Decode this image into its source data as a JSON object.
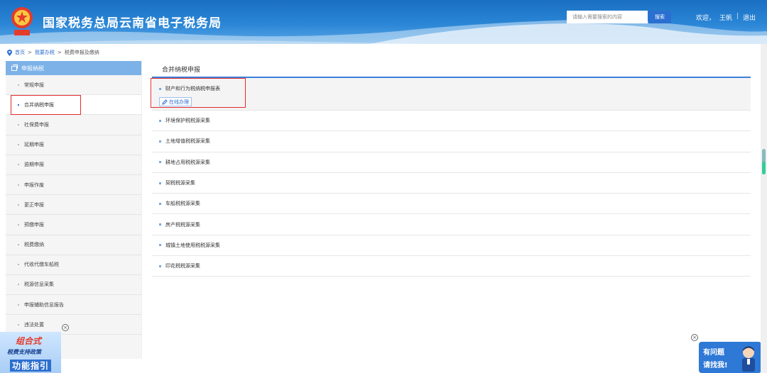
{
  "header": {
    "site_title": "国家税务总局云南省电子税务局",
    "search_placeholder": "请输入需要搜索的内容",
    "search_button": "搜索",
    "welcome": "欢迎，",
    "user_name": "王帆",
    "separator": "|",
    "logout": "退出"
  },
  "breadcrumb": {
    "home": "首页",
    "sep1": ">",
    "level1": "我要办税",
    "sep2": ">",
    "current": "税费申报及缴纳"
  },
  "sidebar": {
    "header": "申报纳税",
    "items": [
      {
        "label": "常规申报"
      },
      {
        "label": "合并纳税申报"
      },
      {
        "label": "社保费申报"
      },
      {
        "label": "延期申报"
      },
      {
        "label": "逾期申报"
      },
      {
        "label": "申报作废"
      },
      {
        "label": "更正申报"
      },
      {
        "label": "预缴申报"
      },
      {
        "label": "税费缴纳"
      },
      {
        "label": "代收代缴车船税"
      },
      {
        "label": "税源信息采集"
      },
      {
        "label": "申报辅助信息报告"
      },
      {
        "label": "违法处置"
      }
    ],
    "close_symbol": "×"
  },
  "main": {
    "title": "合并纳税申报",
    "rows": [
      {
        "label": "财产和行为税纳税申报表"
      },
      {
        "label": "环境保护税税源采集"
      },
      {
        "label": "土地增值税税源采集"
      },
      {
        "label": "耕地占用税税源采集"
      },
      {
        "label": "契税税源采集"
      },
      {
        "label": "车船税税源采集"
      },
      {
        "label": "房产税税源采集"
      },
      {
        "label": "城镇土地使用税税源采集"
      },
      {
        "label": "印花税税源采集"
      }
    ],
    "online_button": "在线办理"
  },
  "floating": {
    "left_line1": "组合式",
    "left_line2": "税费支持政策",
    "left_line3": "功能指引",
    "right_line1": "有问题",
    "right_line2": "请找我!",
    "close_symbol": "×"
  },
  "colors": {
    "brand_blue": "#2b6fd1",
    "sidebar_header": "#7db2e8",
    "highlight_red": "#e32b2b"
  }
}
